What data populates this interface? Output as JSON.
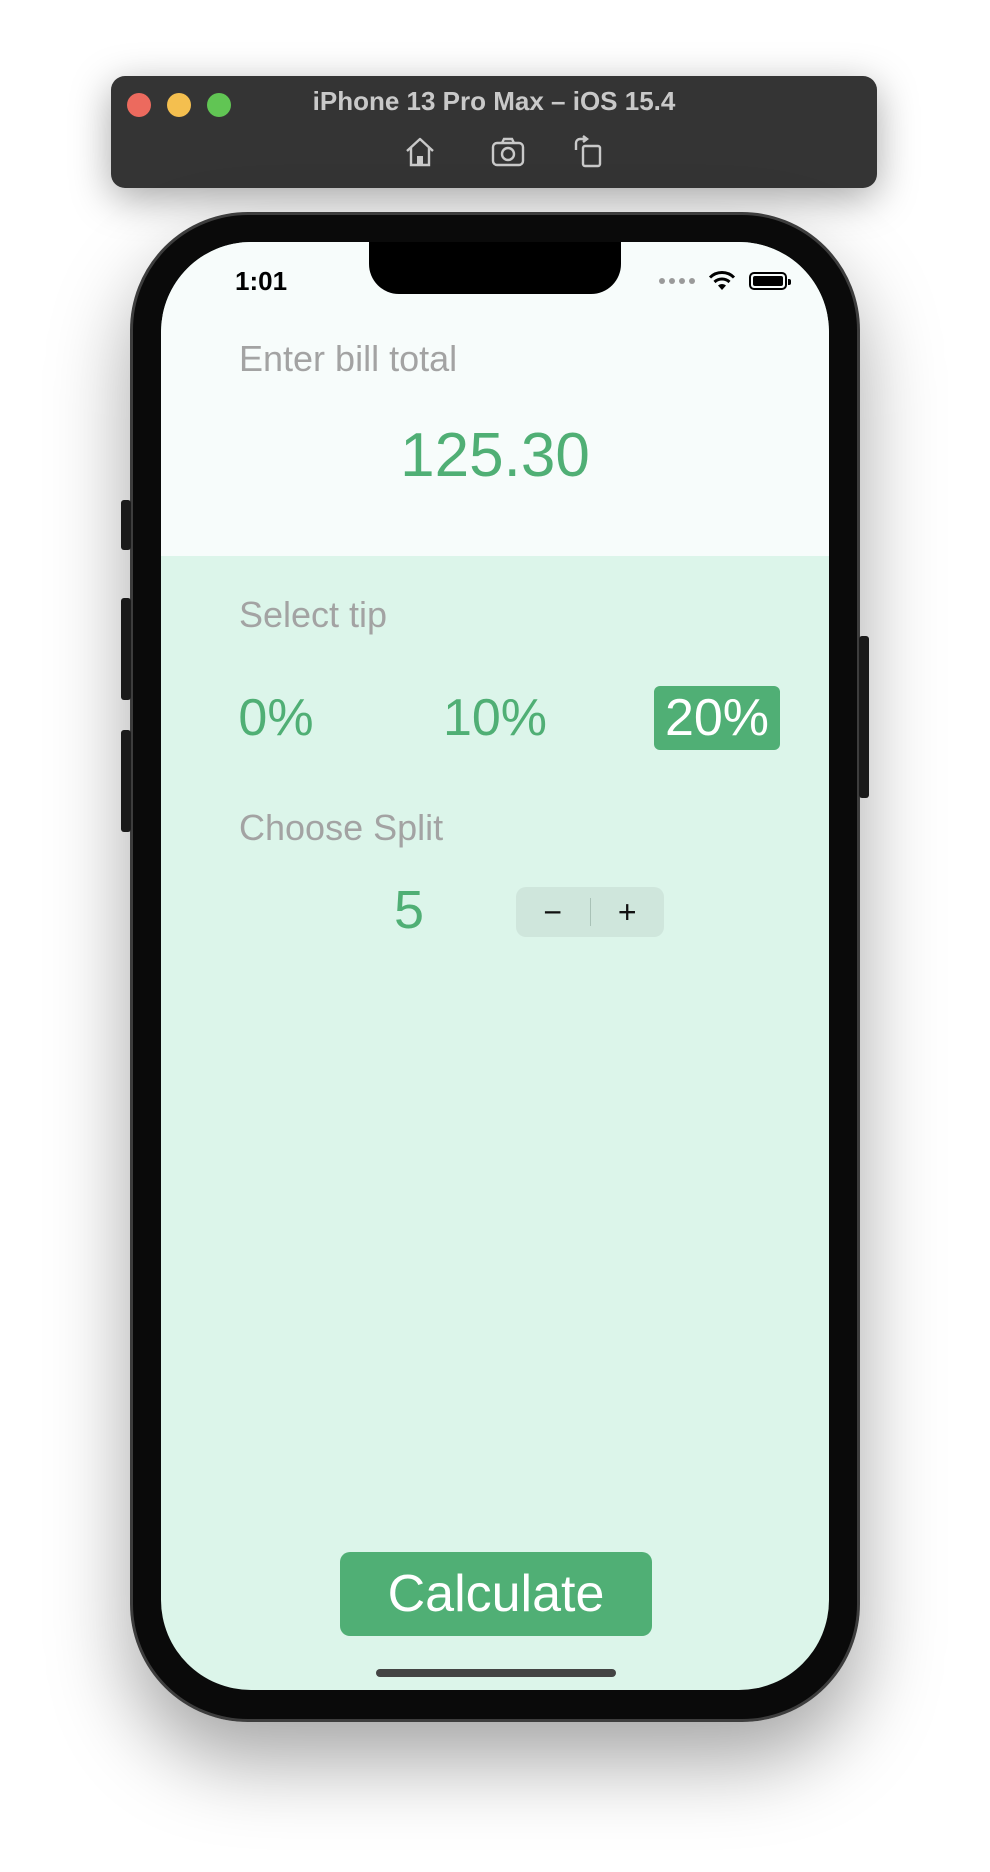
{
  "simulator": {
    "title": "iPhone 13 Pro Max – iOS 15.4",
    "toolbar_icons": [
      "home-icon",
      "screenshot-icon",
      "rotate-icon"
    ]
  },
  "status_bar": {
    "time": "1:01"
  },
  "bill": {
    "label": "Enter bill total",
    "value": "125.30"
  },
  "tip": {
    "label": "Select tip",
    "options": [
      "0%",
      "10%",
      "20%"
    ],
    "selected": "20%"
  },
  "split": {
    "label": "Choose Split",
    "value": "5",
    "decrement_label": "−",
    "increment_label": "+"
  },
  "calculate": {
    "label": "Calculate"
  },
  "colors": {
    "accent": "#50af75",
    "background": "#dcf5ea",
    "top_background": "#f7fcfb",
    "label": "#a3a3a3"
  }
}
